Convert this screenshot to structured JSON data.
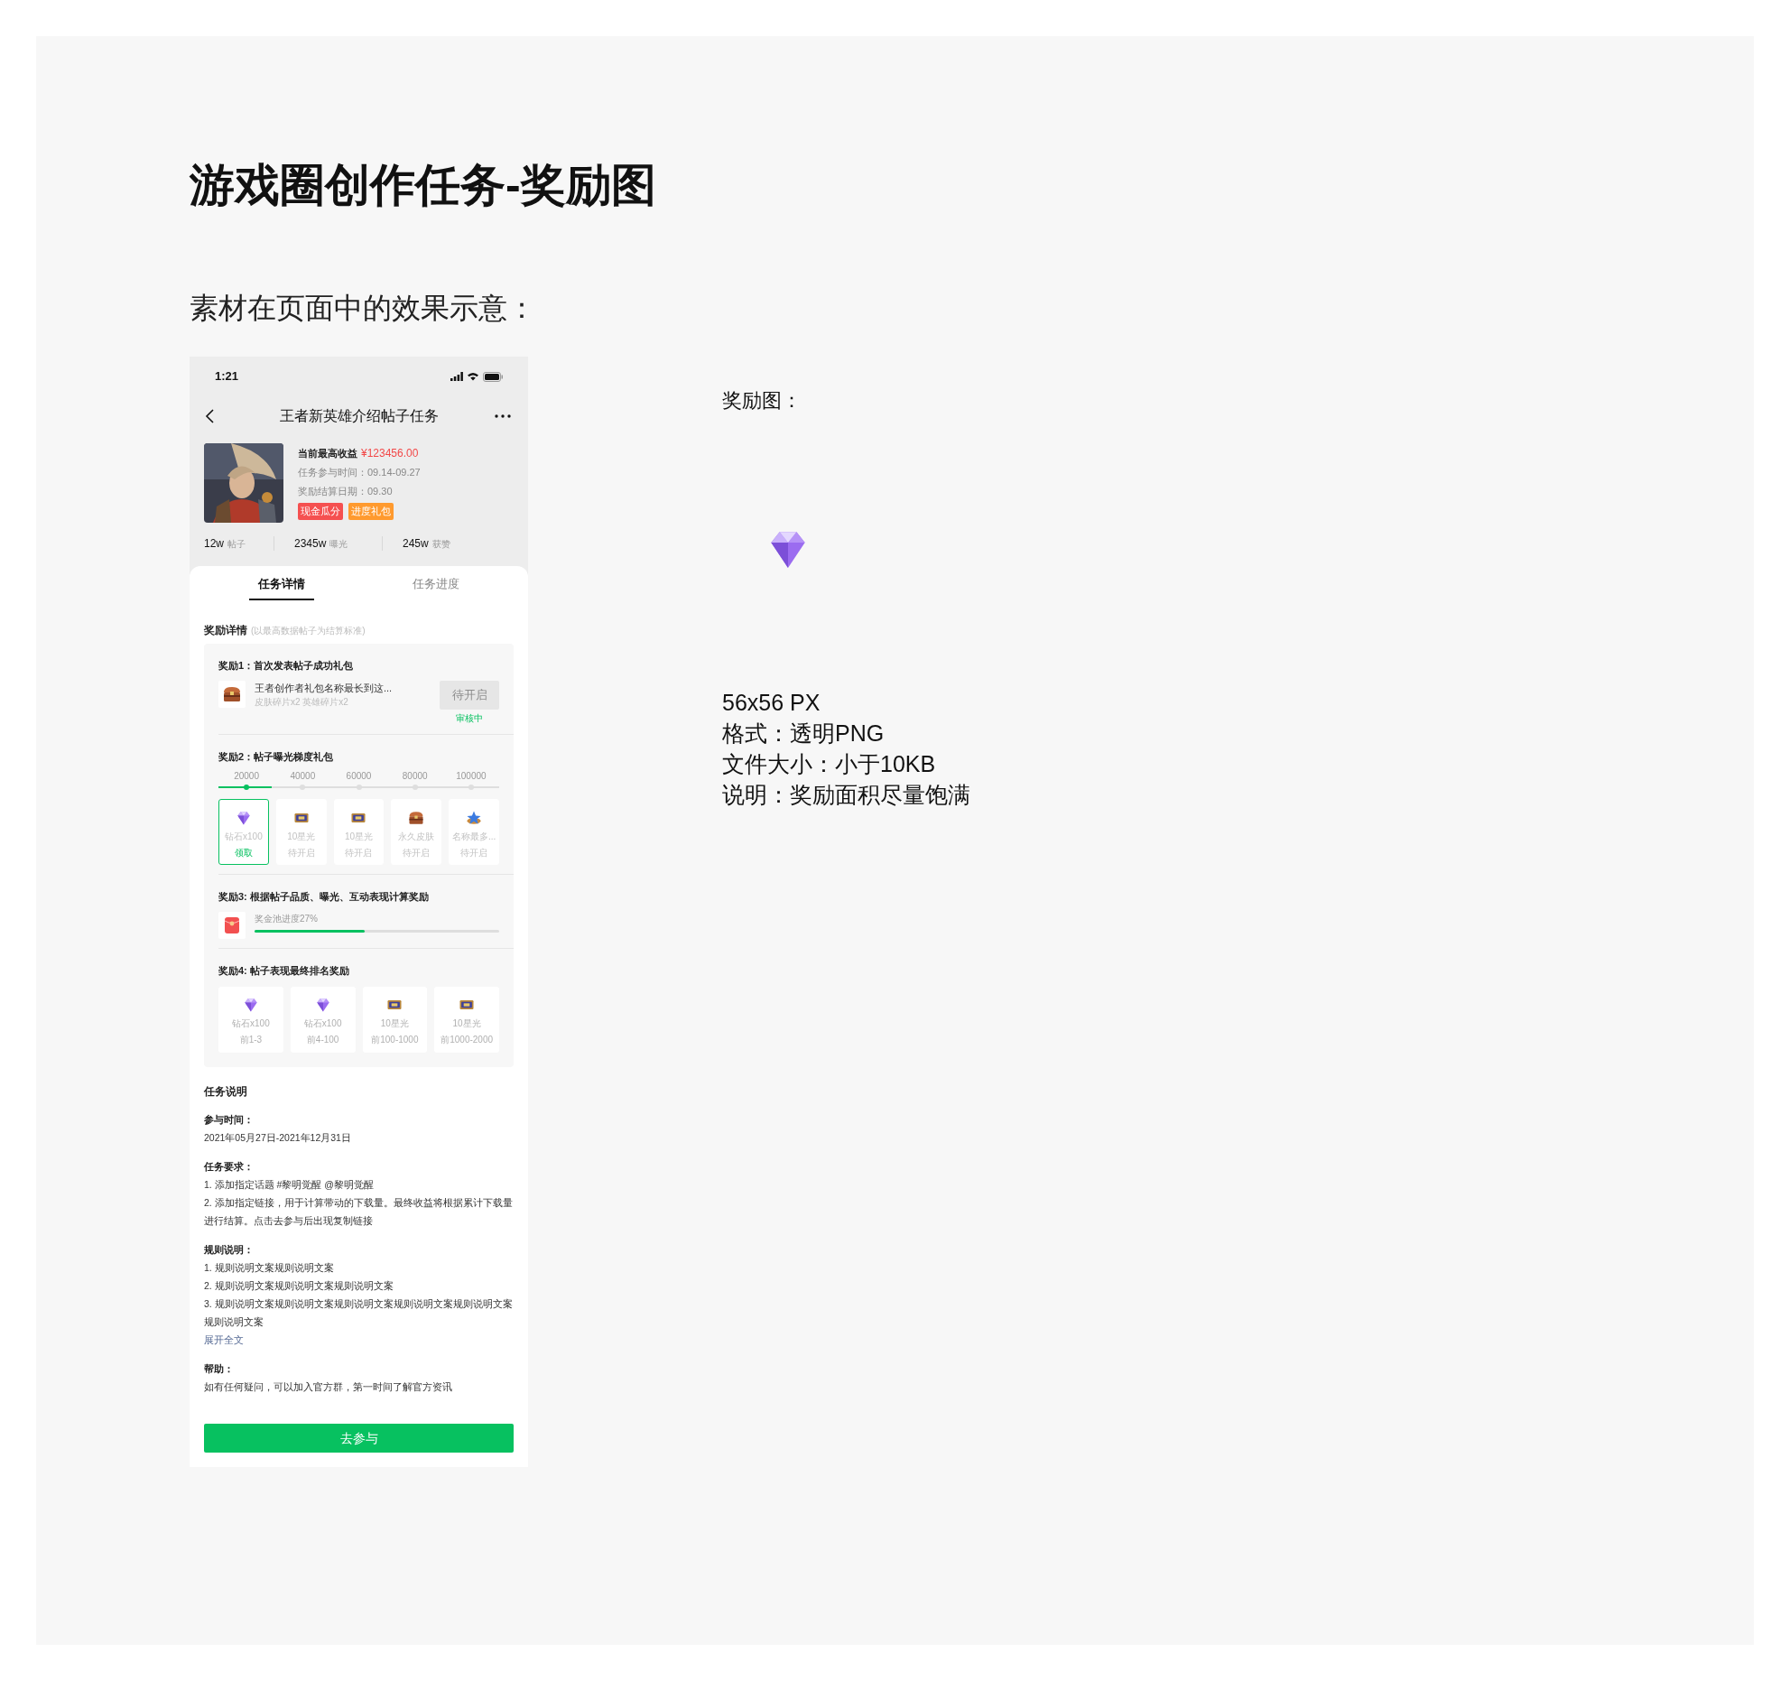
{
  "page": {
    "title": "游戏圈创作任务-奖励图",
    "subtitle": "素材在页面中的效果示意："
  },
  "phone": {
    "status_bar": {
      "time": "1:21"
    },
    "nav": {
      "title": "王者新英雄介绍帖子任务"
    },
    "task": {
      "earnings_label": "当前最高收益",
      "earnings_value": "¥123456.00",
      "time_line": "任务参与时间：09.14-09.27",
      "settle_line": "奖励结算日期：09.30",
      "tags": [
        {
          "label": "现金瓜分",
          "color": "#f55050"
        },
        {
          "label": "进度礼包",
          "color": "#ff9a2e"
        }
      ]
    },
    "stats": [
      {
        "value": "12w",
        "unit": "帖子"
      },
      {
        "value": "2345w",
        "unit": "曝光"
      },
      {
        "value": "245w",
        "unit": "获赞"
      }
    ],
    "tabs": [
      {
        "label": "任务详情",
        "selected": true
      },
      {
        "label": "任务进度",
        "selected": false
      }
    ],
    "reward_details": {
      "title": "奖励详情",
      "note": "(以最高数据帖子为结算标准)"
    },
    "reward1": {
      "title": "奖励1：首次发表帖子成功礼包",
      "kind": "chest",
      "name": "王者创作者礼包名称最长到这...",
      "desc": "皮肤碎片x2 英雄碎片x2",
      "button": {
        "label": "待开启",
        "disabled": true
      },
      "status": "审核中"
    },
    "reward2": {
      "title": "奖励2：帖子曝光梯度礼包",
      "level": 0.19,
      "milestones": [
        {
          "label": "20000",
          "reached": true
        },
        {
          "label": "40000",
          "reached": false
        },
        {
          "label": "60000",
          "reached": false
        },
        {
          "label": "80000",
          "reached": false
        },
        {
          "label": "100000",
          "reached": false
        }
      ],
      "tiers": [
        {
          "kind": "diamond",
          "name": "钻石x100",
          "status": "领取",
          "claimable": true
        },
        {
          "kind": "ticket",
          "name": "10星光",
          "status": "待开启",
          "claimable": false
        },
        {
          "kind": "ticket",
          "name": "10星光",
          "status": "待开启",
          "claimable": false
        },
        {
          "kind": "chest",
          "name": "永久皮肤",
          "status": "待开启",
          "claimable": false
        },
        {
          "kind": "badge",
          "name": "名称最多...",
          "status": "待开启",
          "claimable": false
        }
      ]
    },
    "reward3": {
      "title": "奖励3: 根据帖子品质、曝光、互动表现计算奖励",
      "kind": "envelope",
      "label": "奖金池进度27%",
      "level": 0.45
    },
    "reward4": {
      "title": "奖励4: 帖子表现最终排名奖励",
      "items": [
        {
          "kind": "diamond",
          "name": "钻石x100",
          "rank": "前1-3"
        },
        {
          "kind": "diamond",
          "name": "钻石x100",
          "rank": "前4-100"
        },
        {
          "kind": "ticket",
          "name": "10星光",
          "rank": "前100-1000"
        },
        {
          "kind": "ticket",
          "name": "10星光",
          "rank": "前1000-2000"
        }
      ]
    },
    "description": {
      "title": "任务说明",
      "sections": [
        {
          "heading": "参与时间：",
          "lines": [
            "2021年05月27日-2021年12月31日"
          ]
        },
        {
          "heading": "任务要求：",
          "lines": [
            "1. 添加指定话题 #黎明觉醒 @黎明觉醒",
            "2. 添加指定链接，用于计算带动的下载量。最终收益将根据累计下载量进行结算。点击去参与后出现复制链接"
          ]
        },
        {
          "heading": "规则说明：",
          "lines": [
            "1. 规则说明文案规则说明文案",
            "2. 规则说明文案规则说明文案规则说明文案",
            "3. 规则说明文案规则说明文案规则说明文案规则说明文案规则说明文案规则说明文案"
          ],
          "link": "展开全文"
        },
        {
          "heading": "帮助：",
          "lines": [
            "如有任何疑问，可以加入官方群，第一时间了解官方资讯"
          ]
        }
      ]
    },
    "button": "去参与"
  },
  "asset": {
    "label": "奖励图：",
    "kind": "diamond",
    "specs": [
      "56x56 PX",
      "格式：透明PNG",
      "文件大小：小于10KB",
      "说明：奖励面积尽量饱满"
    ]
  }
}
